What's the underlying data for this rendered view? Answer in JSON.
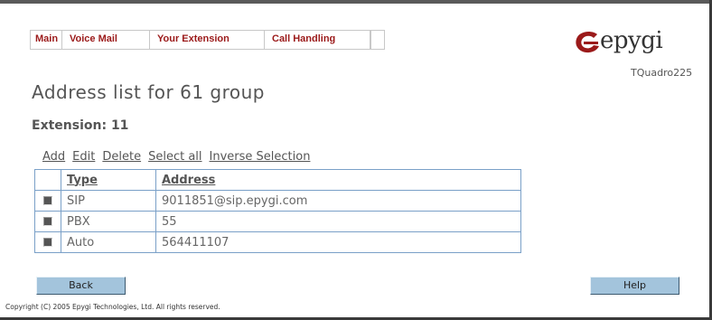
{
  "menu": {
    "items": [
      {
        "label": "Main"
      },
      {
        "label": "Voice Mail"
      },
      {
        "label": "Your Extension"
      },
      {
        "label": "Call Handling"
      }
    ]
  },
  "logo": {
    "text": "epygi",
    "model": "TQuadro225",
    "brand_color": "#9b1a1a"
  },
  "page": {
    "title": "Address list for 61 group",
    "subtitle": "Extension: 11"
  },
  "actions": {
    "add": "Add",
    "edit": "Edit",
    "delete": "Delete",
    "select_all": "Select all",
    "inverse": "Inverse Selection"
  },
  "table": {
    "headers": {
      "type": "Type",
      "address": "Address"
    },
    "rows": [
      {
        "type": "SIP",
        "address": "9011851@sip.epygi.com",
        "checked": false
      },
      {
        "type": "PBX",
        "address": "55",
        "checked": false
      },
      {
        "type": "Auto",
        "address": "564411107",
        "checked": false
      }
    ]
  },
  "buttons": {
    "back": "Back",
    "help": "Help"
  },
  "footer": {
    "copyright": "Copyright (C) 2005 Epygi Technologies, Ltd. All rights reserved."
  },
  "colors": {
    "table_border": "#7aa0c8",
    "button": "#a3c4dc",
    "menu_text": "#9b1a1a"
  }
}
